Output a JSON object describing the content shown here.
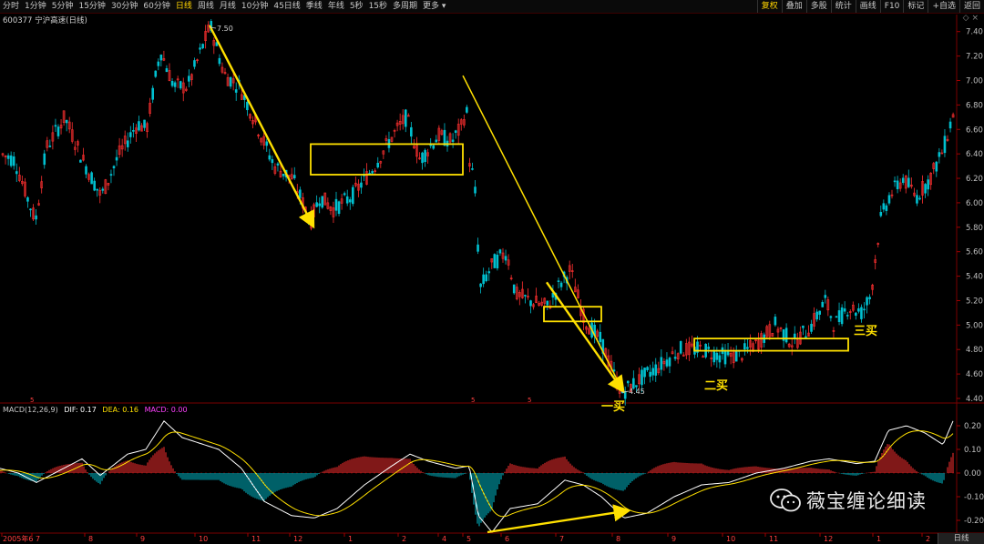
{
  "toolbar": {
    "period_items": [
      "分时",
      "1分钟",
      "5分钟",
      "15分钟",
      "30分钟",
      "60分钟",
      "日线",
      "周线",
      "月线",
      "10分钟",
      "45日线",
      "季线",
      "年线",
      "5秒",
      "15秒",
      "多周期",
      "更多"
    ],
    "active_index": 6,
    "right_buttons": [
      "复权",
      "叠加",
      "多股",
      "统计",
      "画线",
      "F10",
      "标记",
      "+自选",
      "返回"
    ],
    "right_active_index": 0
  },
  "chart_title": "600377 宁沪高速(日线)",
  "macd": {
    "label": "MACD(12,26,9)",
    "dif_label": "DIF: 0.17",
    "dea_label": "DEA: 0.16",
    "macd_label": "MACD: 0.00"
  },
  "price_axis_labels": [
    "7.40",
    "7.20",
    "7.00",
    "6.80",
    "6.60",
    "6.40",
    "6.20",
    "6.00",
    "5.80",
    "5.60",
    "5.40",
    "5.20",
    "5.00",
    "4.80",
    "4.60",
    "4.40"
  ],
  "macd_axis_labels": [
    "0.20",
    "0.10",
    "0.00",
    "-0.10",
    "-0.20"
  ],
  "date_axis_labels": [
    "2005年6",
    "7",
    "8",
    "9",
    "10",
    "11",
    "12",
    "1",
    "2",
    "4",
    "5",
    "6",
    "7",
    "8",
    "9",
    "10",
    "11",
    "12",
    "1",
    "2"
  ],
  "annotations": {
    "high_value": "7.50",
    "low_value": "4.45",
    "buy1": "一买",
    "buy2": "二买",
    "buy3": "三买",
    "marker_5a": "5",
    "marker_5b": "5",
    "marker_5c": "5"
  },
  "watermark": "薇宝缠论细读",
  "bottom_badge": "日线",
  "colors": {
    "up": "#ff3030",
    "down": "#00c0d0",
    "yellow": "#ffe000",
    "dif": "#ffffff",
    "dea": "#ffe000"
  }
}
